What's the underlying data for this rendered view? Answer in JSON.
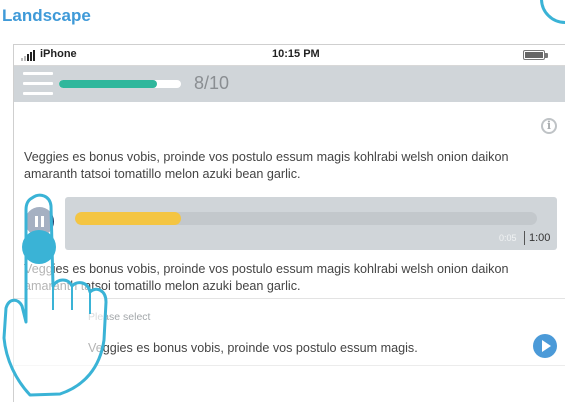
{
  "heading": "Landscape",
  "status_bar": {
    "carrier": "iPhone",
    "time": "10:15 PM"
  },
  "lesson": {
    "progress_text": "8/10",
    "progress_fraction": 0.8
  },
  "paragraph_1": "Veggies es bonus vobis, proinde vos postulo essum magis kohlrabi welsh onion daikon amaranth tatsoi tomatillo melon azuki bean garlic.",
  "audio": {
    "current_time": "0:05",
    "total_time": "1:00",
    "played_fraction": 0.23
  },
  "paragraph_2": "Veggies es bonus vobis, proinde vos postulo essum magis kohlrabi welsh onion daikon amaranth tatsoi tomatillo melon azuki bean garlic.",
  "question": {
    "select_label": "Please select",
    "option_text": "Veggies es bonus vobis, proinde vos postulo essum magis."
  },
  "icons": {
    "menu": "menu-icon",
    "info": "info-icon",
    "pause": "pause-icon",
    "next": "play-arrow-icon",
    "touch": "hand-pointer-icon"
  },
  "colors": {
    "heading": "#3f9ad8",
    "progress": "#2fb79c",
    "audio_progress": "#f4c542",
    "pause_button": "#1f3b68",
    "touch_point": "#3ab3d6",
    "next_button": "#4b9ad8"
  }
}
